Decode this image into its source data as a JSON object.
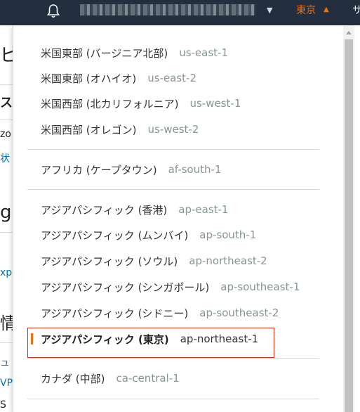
{
  "topbar": {
    "current_region": "東京",
    "support_label_clipped": "サ"
  },
  "background": {
    "frag1": "ビ",
    "frag2": "ス",
    "frag3": "zo",
    "frag4": "状",
    "frag5": "g",
    "frag6": "xp",
    "frag7": "情",
    "frag8": "ュ",
    "frag9": "VP",
    "frag10": "S"
  },
  "regions": [
    {
      "name": "米国東部 (バージニア北部)",
      "code": "us-east-1"
    },
    {
      "name": "米国東部 (オハイオ)",
      "code": "us-east-2"
    },
    {
      "name": "米国西部 (北カリフォルニア)",
      "code": "us-west-1"
    },
    {
      "name": "米国西部 (オレゴン)",
      "code": "us-west-2"
    },
    {
      "name": "アフリカ (ケープタウン)",
      "code": "af-south-1"
    },
    {
      "name": "アジアパシフィック (香港)",
      "code": "ap-east-1"
    },
    {
      "name": "アジアパシフィック (ムンバイ)",
      "code": "ap-south-1"
    },
    {
      "name": "アジアパシフィック (ソウル)",
      "code": "ap-northeast-2"
    },
    {
      "name": "アジアパシフィック (シンガポール)",
      "code": "ap-southeast-1"
    },
    {
      "name": "アジアパシフィック (シドニー)",
      "code": "ap-southeast-2"
    },
    {
      "name": "アジアパシフィック (東京)",
      "code": "ap-northeast-1",
      "selected": true
    },
    {
      "name": "カナダ (中部)",
      "code": "ca-central-1"
    }
  ],
  "colors": {
    "accent": "#ec7211",
    "nav_bg": "#232f3e",
    "highlight_border": "#d13212"
  }
}
